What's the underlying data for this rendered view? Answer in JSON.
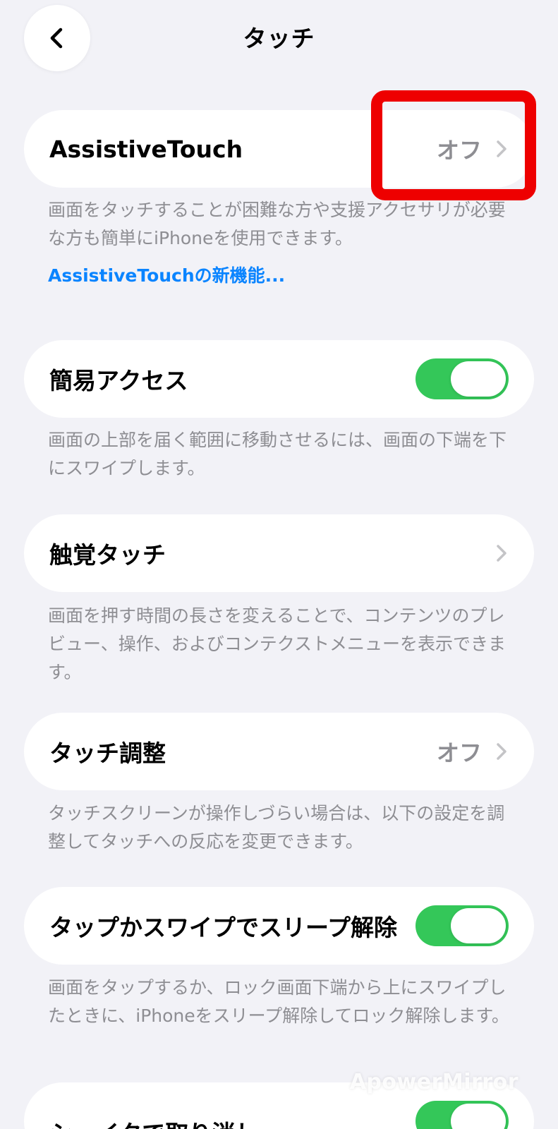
{
  "header": {
    "title": "タッチ",
    "back_icon": "chevron-left-icon"
  },
  "items": {
    "assistive_touch": {
      "label": "AssistiveTouch",
      "value": "オフ",
      "footer": "画面をタッチすることが困難な方や支援アクセサリが必要な方も簡単にiPhoneを使用できます。",
      "link": "AssistiveTouchの新機能..."
    },
    "reachability": {
      "label": "簡易アクセス",
      "toggle_on": true,
      "footer": "画面の上部を届く範囲に移動させるには、画面の下端を下にスワイプします。"
    },
    "haptic_touch": {
      "label": "触覚タッチ",
      "footer": "画面を押す時間の長さを変えることで、コンテンツのプレビュー、操作、およびコンテクストメニューを表示できます。"
    },
    "touch_accommodations": {
      "label": "タッチ調整",
      "value": "オフ",
      "footer": "タッチスクリーンが操作しづらい場合は、以下の設定を調整してタッチへの反応を変更できます。"
    },
    "tap_to_wake": {
      "label": "タップかスワイプでスリープ解除",
      "toggle_on": true,
      "footer": "画面をタップするか、ロック画面下端から上にスワイプしたときに、iPhoneをスリープ解除してロック解除します。"
    },
    "shake_to_undo": {
      "label": "シェイクで取り消し",
      "toggle_on": true
    }
  },
  "overlay": {
    "watermark": "ApowerMirror"
  },
  "colors": {
    "background": "#f2f2f7",
    "card": "#ffffff",
    "toggle_on": "#34c759",
    "link": "#0a84ff",
    "secondary_text": "#8e8e93",
    "highlight": "#ee0000"
  }
}
